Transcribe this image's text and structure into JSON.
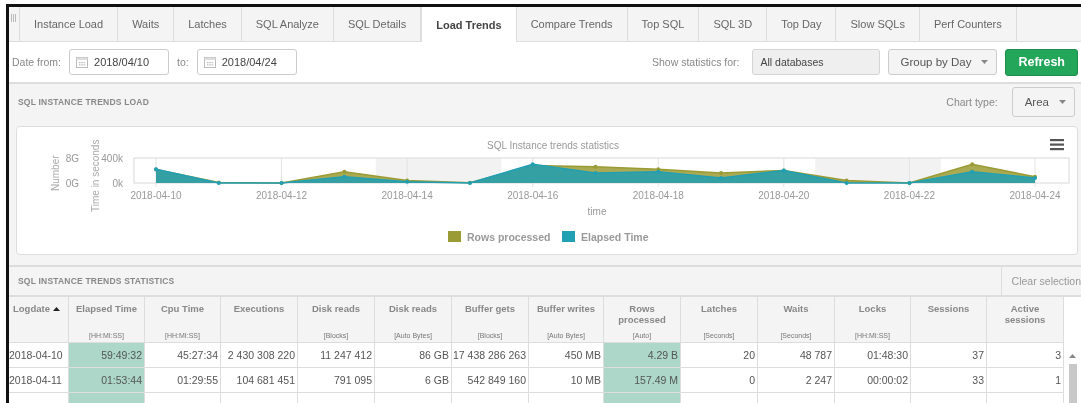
{
  "tabs": [
    {
      "label": "Instance Load",
      "selected": false
    },
    {
      "label": "Waits",
      "selected": false
    },
    {
      "label": "Latches",
      "selected": false
    },
    {
      "label": "SQL Analyze",
      "selected": false
    },
    {
      "label": "SQL Details",
      "selected": false
    },
    {
      "label": "Load Trends",
      "selected": true
    },
    {
      "label": "Compare Trends",
      "selected": false
    },
    {
      "label": "Top SQL",
      "selected": false
    },
    {
      "label": "SQL 3D",
      "selected": false
    },
    {
      "label": "Top Day",
      "selected": false
    },
    {
      "label": "Slow SQLs",
      "selected": false
    },
    {
      "label": "Perf Counters",
      "selected": false
    }
  ],
  "filters": {
    "date_from_label": "Date from:",
    "date_from": "2018/04/10",
    "date_to_label": "to:",
    "date_to": "2018/04/24",
    "statistics_label": "Show statistics for:",
    "database": "All databases",
    "grouping": "Group by Day",
    "refresh": "Refresh"
  },
  "trends_load": {
    "title": "SQL INSTANCE TRENDS LOAD",
    "chart_type_label": "Chart type:",
    "chart_type": "Area",
    "chart": {
      "title": "SQL Instance trends statistics",
      "y2_label": "Number",
      "y_label": "Time in seconds",
      "x_label": "time",
      "y2_ticks": [
        "8G",
        "0G"
      ],
      "y_ticks": [
        "400k",
        "0k"
      ],
      "x_ticks": [
        "2018-04-10",
        "2018-04-12",
        "2018-04-14",
        "2018-04-16",
        "2018-04-18",
        "2018-04-20",
        "2018-04-22",
        "2018-04-24"
      ],
      "legend": [
        {
          "label": "Rows processed",
          "color": "#9b9b35"
        },
        {
          "label": "Elapsed Time",
          "color": "#219fb3"
        }
      ]
    }
  },
  "statistics": {
    "title": "SQL INSTANCE TRENDS STATISTICS",
    "clear_selection": "Clear selection",
    "columns": [
      {
        "title": "Logdate",
        "sorted": true,
        "selected": false
      },
      {
        "title": "Elapsed Time",
        "unit": "[HH:MI:SS]",
        "selected": true
      },
      {
        "title": "Cpu Time",
        "unit": "[HH:MI:SS]",
        "selected": false
      },
      {
        "title": "Executions",
        "selected": false
      },
      {
        "title": "Disk reads",
        "unit": "[Blocks]",
        "selected": false
      },
      {
        "title": "Disk reads",
        "unit": "[Auto Bytes]",
        "selected": false
      },
      {
        "title": "Buffer gets",
        "unit": "[Blocks]",
        "selected": false
      },
      {
        "title": "Buffer writes",
        "unit": "[Auto Bytes]",
        "selected": false
      },
      {
        "title": "Rows processed",
        "unit": "[Auto]",
        "selected": true
      },
      {
        "title": "Latches",
        "unit": "[Seconds]",
        "selected": false
      },
      {
        "title": "Waits",
        "unit": "[Seconds]",
        "selected": false
      },
      {
        "title": "Locks",
        "unit": "[HH:MI:SS]",
        "selected": false
      },
      {
        "title": "Sessions",
        "selected": false
      },
      {
        "title": "Active sessions",
        "selected": false
      }
    ],
    "rows": [
      [
        "2018-04-10",
        "59:49:32",
        "45:27:34",
        "2 430 308 220",
        "11 247 412",
        "86 GB",
        "17 438 286 263",
        "450 MB",
        "4.29 B",
        "20",
        "48 787",
        "01:48:30",
        "37",
        "3"
      ],
      [
        "2018-04-11",
        "01:53:44",
        "01:29:55",
        "104 681 451",
        "791 095",
        "6 GB",
        "542 849 160",
        "10 MB",
        "157.49 M",
        "0",
        "2 247",
        "00:00:02",
        "33",
        "1"
      ]
    ]
  }
}
